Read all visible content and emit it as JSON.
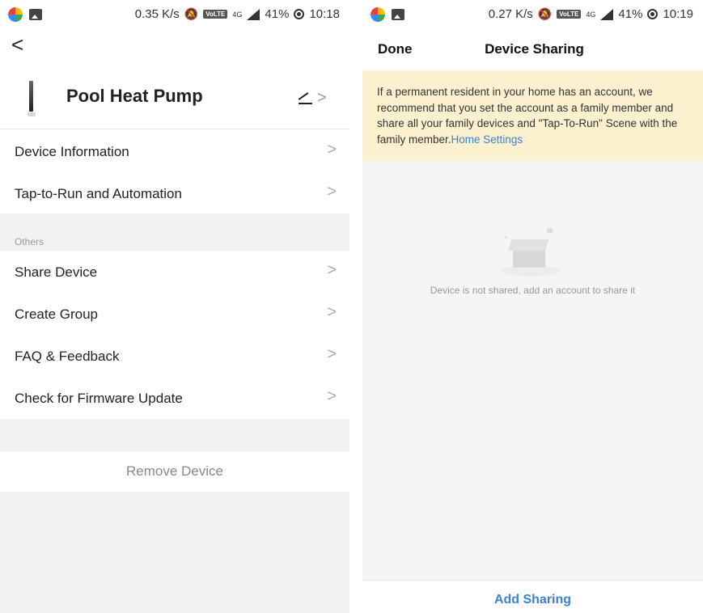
{
  "left": {
    "status": {
      "speed": "0.35 K/s",
      "volte": "VoLTE",
      "network": "4G",
      "battery": "41%",
      "time": "10:18"
    },
    "device": {
      "name": "Pool Heat Pump"
    },
    "menu_group1": [
      {
        "label": "Device Information"
      },
      {
        "label": "Tap-to-Run and Automation"
      }
    ],
    "section_label": "Others",
    "menu_group2": [
      {
        "label": "Share Device"
      },
      {
        "label": "Create Group"
      },
      {
        "label": "FAQ & Feedback"
      },
      {
        "label": "Check for Firmware Update"
      }
    ],
    "remove_label": "Remove Device",
    "icons": {
      "back": "<",
      "chevron": ">"
    }
  },
  "right": {
    "status": {
      "speed": "0.27 K/s",
      "volte": "VoLTE",
      "network": "4G",
      "battery": "41%",
      "time": "10:19"
    },
    "nav": {
      "done": "Done",
      "title": "Device Sharing"
    },
    "notice": {
      "text": "If a permanent resident in your home has an account, we recommend that you set the account as a family member and share all your family devices and \"Tap-To-Run\" Scene with the family member.",
      "link": "Home Settings"
    },
    "empty_message": "Device is not shared, add an account to share it",
    "add_button": "Add Sharing"
  },
  "colors": {
    "accent_blue": "#3b82d6",
    "notice_bg": "#fbf1cf",
    "page_bg": "#f2f2f2"
  }
}
